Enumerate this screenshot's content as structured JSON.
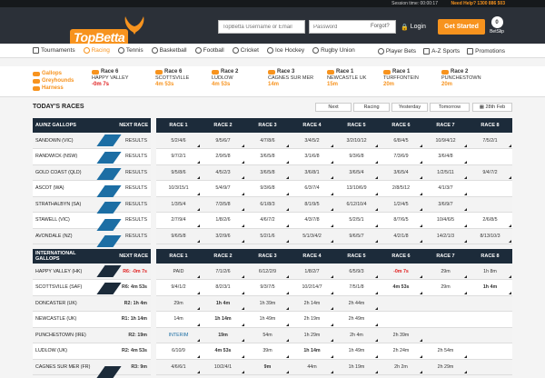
{
  "topbar": {
    "session_label": "Session time: 00:00:17",
    "help_label": "Need Help? 1300 886 503"
  },
  "header": {
    "logo_text": "TopBetta",
    "username_placeholder": "TopBetta Username or Email",
    "password_placeholder": "Password",
    "forgot_label": "Forgot?",
    "login_label": "Login",
    "get_started_label": "Get Started",
    "betslip_count": "0",
    "betslip_label": "BetSlip"
  },
  "nav": {
    "items": [
      {
        "label": "Tournaments",
        "icon": "trophy-icon"
      },
      {
        "label": "Racing",
        "icon": "horse-icon"
      },
      {
        "label": "Tennis",
        "icon": "tennis-icon"
      },
      {
        "label": "Basketball",
        "icon": "basketball-icon"
      },
      {
        "label": "Football",
        "icon": "football-icon"
      },
      {
        "label": "Cricket",
        "icon": "cricket-icon"
      },
      {
        "label": "Ice Hockey",
        "icon": "hockey-icon"
      },
      {
        "label": "Rugby Union",
        "icon": "rugby-icon"
      }
    ],
    "right_items": [
      {
        "label": "Player Bets",
        "icon": "player-icon"
      },
      {
        "label": "A-Z Sports",
        "icon": "list-icon"
      },
      {
        "label": "Promotions",
        "icon": "gift-icon"
      }
    ],
    "accent": "#f7931e"
  },
  "race_types": [
    "Gallops",
    "Greyhounds",
    "Harness"
  ],
  "next_races": [
    {
      "race": "Race 6",
      "venue": "HAPPY VALLEY",
      "time": "-0m 7s",
      "red": true
    },
    {
      "race": "Race 6",
      "venue": "SCOTTSVILLE",
      "time": "4m 53s",
      "red": false
    },
    {
      "race": "Race 2",
      "venue": "LUDLOW",
      "time": "4m 53s",
      "red": false
    },
    {
      "race": "Race 3",
      "venue": "CAGNES SUR MER",
      "time": "14m",
      "red": false
    },
    {
      "race": "Race 1",
      "venue": "NEWCASTLE UK",
      "time": "15m",
      "red": false
    },
    {
      "race": "Race 1",
      "venue": "TURFFONTEIN",
      "time": "20m",
      "red": false
    },
    {
      "race": "Race 2",
      "venue": "PUNCHESTOWN",
      "time": "20m",
      "red": false
    }
  ],
  "controls": {
    "title": "TODAY'S RACES",
    "next": "Next",
    "racing": "Racing",
    "yesterday": "Yesterday",
    "tomorrow": "Tomorrow",
    "date": "28th Feb"
  },
  "aunz": {
    "title": "AU/NZ GALLOPS",
    "next_label": "NEXT RACE",
    "headers": [
      "RACE 1",
      "RACE 2",
      "RACE 3",
      "RACE 4",
      "RACE 5",
      "RACE 6",
      "RACE 7",
      "RACE 8"
    ],
    "rows": [
      {
        "venue": "SANDOWN (VIC)",
        "next": "RESULTS",
        "cells": [
          "5/2/4/6",
          "9/5/6/7",
          "4/7/8/6",
          "3/4/5/2",
          "3/2/10/12",
          "6/8/4/5",
          "10/9/4/12",
          "7/5/2/1"
        ]
      },
      {
        "venue": "RANDWICK (NSW)",
        "next": "RESULTS",
        "cells": [
          "9/7/2/1",
          "2/9/5/8",
          "3/6/5/8",
          "3/1/6/8",
          "9/3/6/8",
          "7/3/6/9",
          "3/6/4/8",
          ""
        ]
      },
      {
        "venue": "GOLD COAST (QLD)",
        "next": "RESULTS",
        "cells": [
          "9/5/8/6",
          "4/5/2/3",
          "3/6/5/8",
          "3/6/8/1",
          "3/6/5/4",
          "3/6/5/4",
          "1/2/5/11",
          "9/4/7/2"
        ]
      },
      {
        "venue": "ASCOT (WA)",
        "next": "RESULTS",
        "cells": [
          "10/3/15/1",
          "5/4/9/7",
          "9/3/6/8",
          "6/3/7/4",
          "13/10/6/9",
          "2/8/5/12",
          "4/1/3/7",
          ""
        ]
      },
      {
        "venue": "STRATHALBYN (SA)",
        "next": "RESULTS",
        "cells": [
          "1/3/5/4",
          "7/3/5/8",
          "6/1/8/3",
          "8/1/9/5",
          "6/12/10/4",
          "1/2/4/5",
          "3/6/9/7",
          ""
        ]
      },
      {
        "venue": "STAWELL (VIC)",
        "next": "RESULTS",
        "cells": [
          "2/7/9/4",
          "1/8/2/6",
          "4/6/7/2",
          "4/3/7/8",
          "5/2/5/1",
          "8/7/6/5",
          "10/4/6/5",
          "2/6/8/5"
        ]
      },
      {
        "venue": "AVONDALE (NZ)",
        "next": "RESULTS",
        "cells": [
          "9/6/5/8",
          "3/2/9/6",
          "5/2/1/6",
          "5/1/3/4/2",
          "9/6/5/7",
          "4/2/1/8",
          "14/2/1/3",
          "8/13/10/3"
        ]
      }
    ]
  },
  "intl": {
    "title": "INTERNATIONAL GALLOPS",
    "next_label": "NEXT RACE",
    "headers": [
      "RACE 1",
      "RACE 2",
      "RACE 3",
      "RACE 4",
      "RACE 5",
      "RACE 6",
      "RACE 7",
      "RACE 8"
    ],
    "rows": [
      {
        "venue": "HAPPY VALLEY (HK)",
        "next": "R6: -0m 7s",
        "cells": [
          "PAID",
          "7/1/2/6",
          "6/12/2/9",
          "1/8/2/7",
          "6/5/9/3",
          "-0m 7s",
          "29m",
          "1h 8m"
        ]
      },
      {
        "venue": "SCOTTSVILLE (SAF)",
        "next": "R6: 4m 53s",
        "cells": [
          "9/4/1/2",
          "8/2/3/1",
          "9/3/7/5",
          "10/2/14/7",
          "7/5/1/8",
          "4m 53s",
          "29m",
          "1h 4m"
        ]
      },
      {
        "venue": "DONCASTER (UK)",
        "next": "R2: 1h 4m",
        "cells": [
          "29m",
          "1h 4m",
          "1h 39m",
          "2h 14m",
          "2h 44m",
          "",
          "",
          ""
        ]
      },
      {
        "venue": "NEWCASTLE (UK)",
        "next": "R1: 1h 14m",
        "cells": [
          "14m",
          "1h 14m",
          "1h 49m",
          "2h 19m",
          "2h 49m",
          "",
          "",
          ""
        ]
      },
      {
        "venue": "PUNCHESTOWN (IRE)",
        "next": "R2: 19m",
        "cells": [
          "INTERIM",
          "19m",
          "54m",
          "1h 29m",
          "2h 4m",
          "2h 39m",
          "",
          ""
        ]
      },
      {
        "venue": "LUDLOW (UK)",
        "next": "R2: 4m 53s",
        "cells": [
          "6/10/9",
          "4m 53s",
          "39m",
          "1h 14m",
          "1h 49m",
          "2h 24m",
          "2h 54m",
          ""
        ]
      },
      {
        "venue": "CAGNES SUR MER (FR)",
        "next": "R3: 9m",
        "cells": [
          "4/6/6/1",
          "10/2/4/1",
          "9m",
          "44m",
          "1h 19m",
          "2h 2m",
          "2h 29m",
          ""
        ]
      }
    ]
  }
}
